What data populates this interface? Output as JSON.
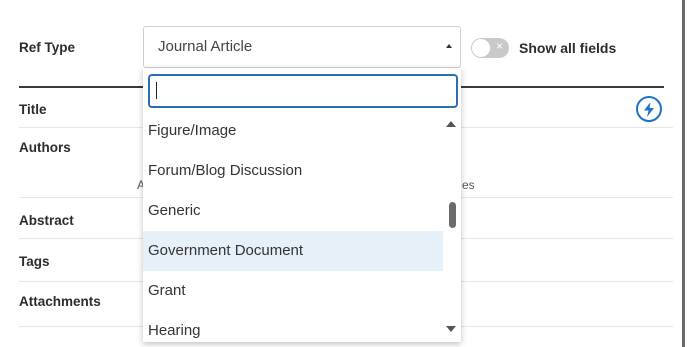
{
  "form": {
    "ref_type_label": "Ref Type",
    "title_label": "Title",
    "authors_label": "Authors",
    "abstract_label": "Abstract",
    "tags_label": "Tags",
    "attachments_label": "Attachments",
    "authors_hint_left": "A",
    "authors_hint_right": "es"
  },
  "ref_type_select": {
    "selected": "Journal Article",
    "search_value": ""
  },
  "toggle": {
    "label": "Show all fields",
    "state": "off",
    "off_glyph": "×"
  },
  "dropdown": {
    "items": [
      {
        "label": "Figure/Image"
      },
      {
        "label": "Forum/Blog Discussion"
      },
      {
        "label": "Generic"
      },
      {
        "label": "Government Document"
      },
      {
        "label": "Grant"
      },
      {
        "label": "Hearing"
      }
    ],
    "highlighted_index": 3
  },
  "colors": {
    "accent": "#1a73c7",
    "focus_border": "#2a6fb5",
    "highlight_bg": "#e6f0f8"
  },
  "icons": {
    "lightning": "lightning-icon"
  }
}
